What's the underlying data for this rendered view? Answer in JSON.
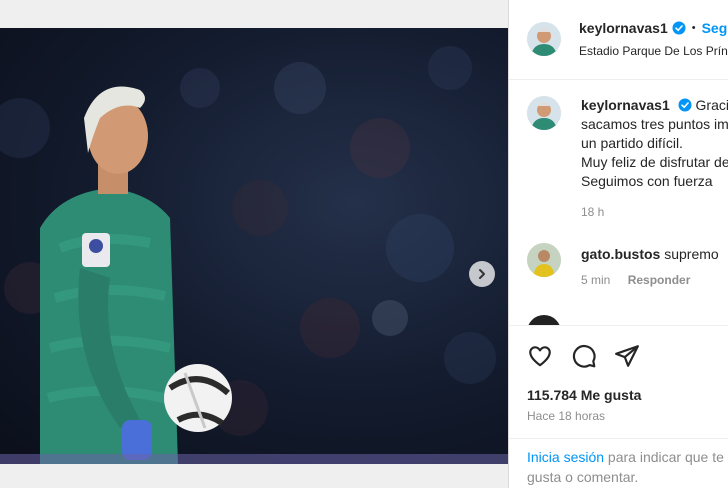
{
  "post": {
    "username": "keylornavas1",
    "follow_label": "Seguir",
    "separator": "•",
    "location": "Estadio Parque De Los Príncipes",
    "icons": {
      "verified": "verified-badge-icon",
      "next": "chevron-right-icon"
    },
    "carousel": {
      "total_slides": 2,
      "active_slide": 1
    }
  },
  "caption": {
    "username": "keylornavas1",
    "lines": [
      "Gracias a todos",
      "sacamos tres puntos importantes en",
      "un partido difícil.",
      "Muy feliz de disfrutar de este juego.",
      "Seguimos con fuerza"
    ],
    "time": "18 h"
  },
  "comments": [
    {
      "username": "gato.bustos",
      "text": "supremo",
      "time": "5 min",
      "reply_label": "Responder"
    }
  ],
  "actions": {
    "likes": "115.784 Me gusta",
    "time_ago": "Hace 18 horas"
  },
  "login": {
    "link_label": "Inicia sesión",
    "text": " para indicar que te gusta o comentar."
  },
  "colors": {
    "accent": "#0095f6",
    "keeper_green": "#2e8b74",
    "muted": "#8e8e8e"
  }
}
